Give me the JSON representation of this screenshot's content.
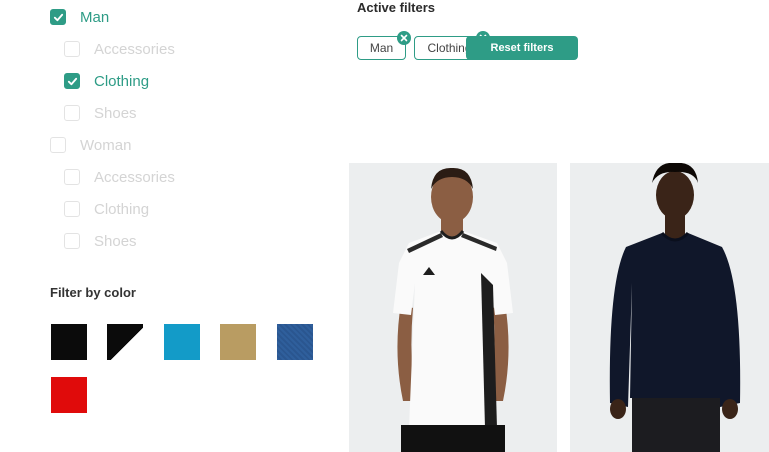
{
  "categories": {
    "man": {
      "label": "Man",
      "checked": true
    },
    "man_accessories": {
      "label": "Accessories",
      "checked": false
    },
    "man_clothing": {
      "label": "Clothing",
      "checked": true
    },
    "man_shoes": {
      "label": "Shoes",
      "checked": false
    },
    "woman": {
      "label": "Woman",
      "checked": false
    },
    "woman_accessories": {
      "label": "Accessories",
      "checked": false
    },
    "woman_clothing": {
      "label": "Clothing",
      "checked": false
    },
    "woman_shoes": {
      "label": "Shoes",
      "checked": false
    }
  },
  "color_filter": {
    "title": "Filter by color",
    "swatches": [
      "#0b0b0b",
      "black-white-diagonal",
      "#139bc8",
      "#b99c62",
      "#2f5f9c",
      "#e00b0b"
    ]
  },
  "active_filters": {
    "title": "Active filters",
    "chips": [
      "Man",
      "Clothing"
    ],
    "reset_label": "Reset filters"
  },
  "colors": {
    "accent": "#2e9c86"
  }
}
